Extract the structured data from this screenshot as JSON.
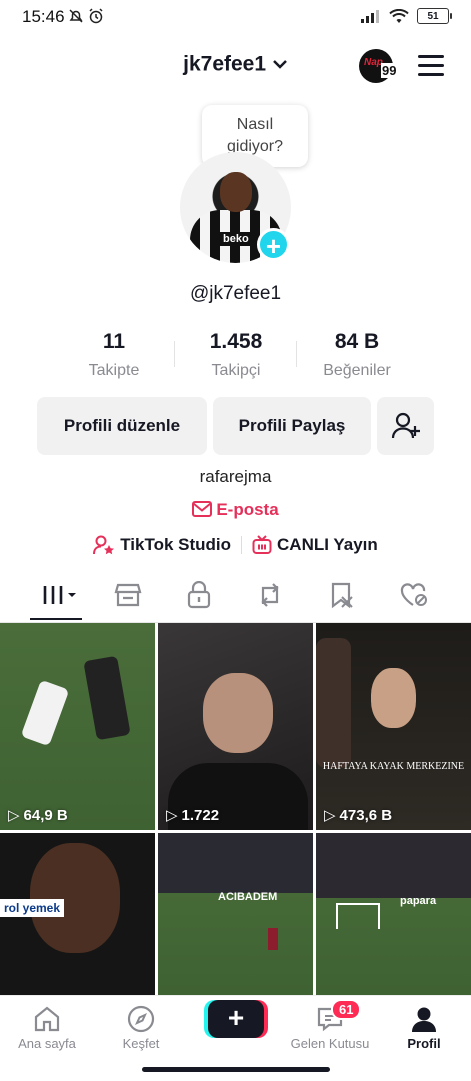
{
  "status_bar": {
    "time": "15:46",
    "battery": "51"
  },
  "header": {
    "username": "jk7efee1",
    "badge_logo": "Nap",
    "badge_count": "99"
  },
  "bubble": {
    "line1": "Nasıl",
    "line2": "gidiyor?"
  },
  "avatar": {
    "sponsor": "beko"
  },
  "profile": {
    "handle": "@jk7efee1",
    "bio": "rafarejma",
    "email_label": "E-posta"
  },
  "stats": [
    {
      "value": "11",
      "label": "Takipte"
    },
    {
      "value": "1.458",
      "label": "Takipçi"
    },
    {
      "value": "84 B",
      "label": "Beğeniler"
    }
  ],
  "buttons": {
    "edit": "Profili düzenle",
    "share": "Profili Paylaş"
  },
  "links": {
    "studio": "TikTok Studio",
    "live": "CANLI Yayın"
  },
  "tabs": [
    "videos-grid-icon",
    "shop-icon",
    "lock-icon",
    "repost-icon",
    "bookmark-icon",
    "liked-icon"
  ],
  "videos": [
    {
      "views": "64,9 B"
    },
    {
      "views": "1.722"
    },
    {
      "views": "473,6 B",
      "caption": "HAFTAYA KAYAK MERKEZINE"
    },
    {
      "views": "",
      "caption": "rol yemek"
    },
    {
      "views": "",
      "caption": "ACIBADEM"
    },
    {
      "views": "",
      "caption": "papara"
    }
  ],
  "nav": {
    "home": "Ana sayfa",
    "discover": "Keşfet",
    "create": "+",
    "inbox": "Gelen Kutusu",
    "inbox_badge": "61",
    "profile": "Profil"
  },
  "colors": {
    "accent": "#fe2c55",
    "email": "#e5305a",
    "cyan": "#20d5ec"
  }
}
